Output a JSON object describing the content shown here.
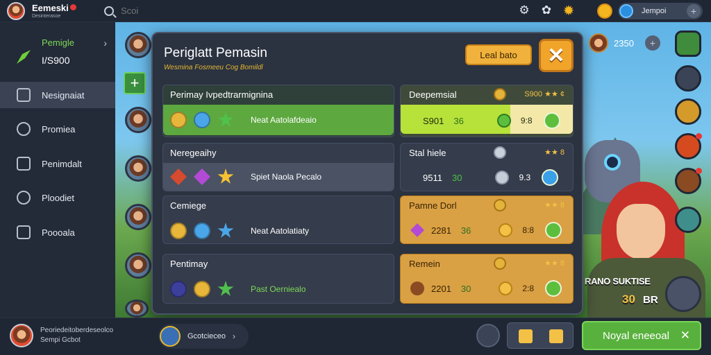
{
  "header": {
    "profile_name": "Eemeski",
    "profile_sub": "Desinterasoe",
    "search_placeholder": "Scoi",
    "currency_value": "Jempoi"
  },
  "sidebar": {
    "header_title": "Pemigle",
    "header_value": "I/S900",
    "items": [
      {
        "label": "Nesignaiat",
        "icon": "checklist-icon"
      },
      {
        "label": "Promiea",
        "icon": "compass-icon"
      },
      {
        "label": "Penimdalt",
        "icon": "hat-icon"
      },
      {
        "label": "Ploodiet",
        "icon": "gear-icon"
      },
      {
        "label": "Poooala",
        "icon": "box-icon"
      }
    ]
  },
  "modal": {
    "title": "Periglatt Pemasin",
    "subtitle": "Wesmina Fosmeeu Cog Bomildl",
    "lead_button": "Leal bato",
    "left_cards": [
      {
        "title": "Perimay Ivpedtrarmignina",
        "row_text": "Neat Aatolafdeaio"
      },
      {
        "title": "Neregeaihy",
        "row_text": "Spiet Naola Pecalo"
      },
      {
        "title": "Cemiege",
        "row_text": "Neat Aatolatiaty"
      },
      {
        "title": "Pentimay",
        "row_text": "Past Oerniealo"
      }
    ],
    "right_cards": [
      {
        "title": "Deepemsial",
        "stars": "S900 ★★ ¢",
        "val1": "S901",
        "val2": "36",
        "val3": "9:8"
      },
      {
        "title": "Stal hiele",
        "stars": "★★ 8",
        "val1": "9511",
        "val2": "30",
        "val3": "9.3"
      },
      {
        "title": "Pamne Dorl",
        "stars": "★★ 8",
        "val1": "2281",
        "val2": "36",
        "val3": "8:8"
      },
      {
        "title": "Remein",
        "stars": "★★ 8",
        "val1": "2201",
        "val2": "30",
        "val3": "2:8"
      }
    ]
  },
  "hud": {
    "count_value": "2350",
    "promo_text": "RANO SUKTISE",
    "promo_value": "30",
    "promo_unit": "BR"
  },
  "footer": {
    "text1": "Peoriedeitoberdeseolco",
    "text2": "Sempi Gcbot",
    "pill_text": "Gcotcieceo",
    "cta_label": "Noyal eneeoal"
  }
}
